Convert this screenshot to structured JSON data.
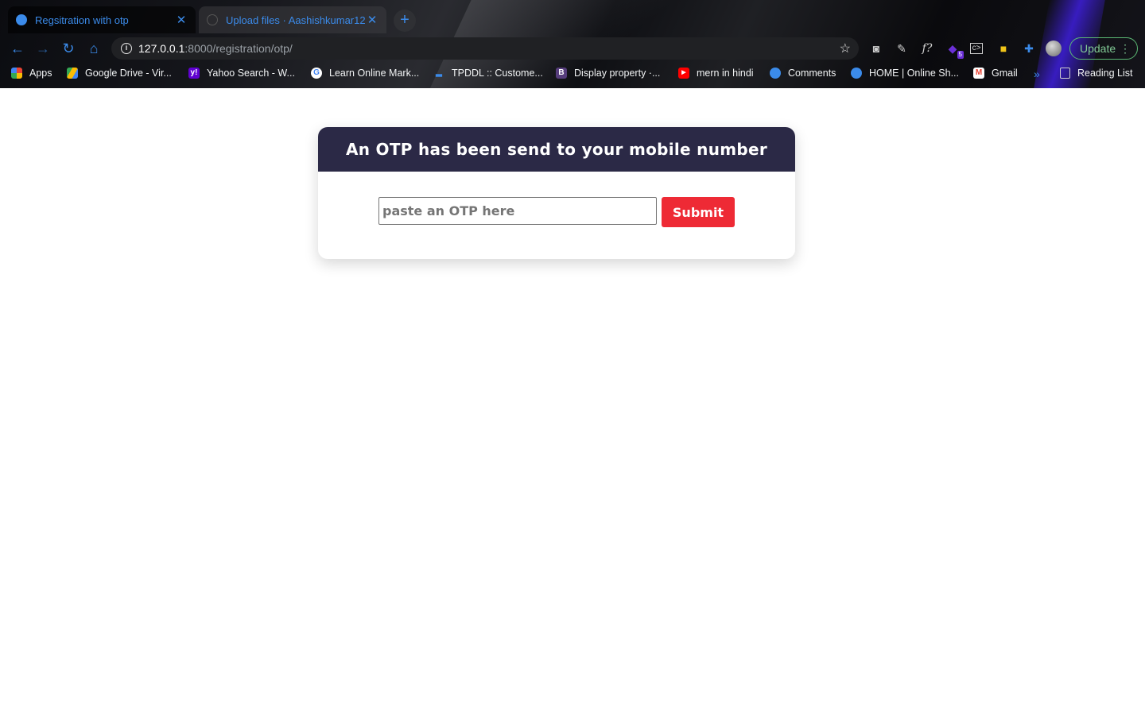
{
  "browser": {
    "tabs": [
      {
        "title": "Regsitration with otp",
        "active": true
      },
      {
        "title": "Upload files · Aashishkumar12…",
        "active": false
      }
    ],
    "new_tab_label": "+",
    "url_host": "127.0.0.1",
    "url_rest": ":8000/registration/otp/",
    "extension_badge": "5",
    "update_label": "Update",
    "bookmarks": [
      {
        "label": "Apps"
      },
      {
        "label": "Google Drive - Vir..."
      },
      {
        "label": "Yahoo Search - W..."
      },
      {
        "label": "Learn Online Mark..."
      },
      {
        "label": "TPDDL :: Custome..."
      },
      {
        "label": "Display property ·..."
      },
      {
        "label": "mern in hindi"
      },
      {
        "label": "Comments"
      },
      {
        "label": "HOME | Online Sh..."
      },
      {
        "label": "Gmail"
      }
    ],
    "reading_list_label": "Reading List",
    "accent_color": "#3b8bea"
  },
  "page": {
    "heading": "An OTP has been send to your mobile number",
    "otp_placeholder": "paste an OTP here",
    "otp_value": "",
    "submit_label": "Submit",
    "header_color": "#2b2946",
    "button_color": "#ee2a35"
  }
}
